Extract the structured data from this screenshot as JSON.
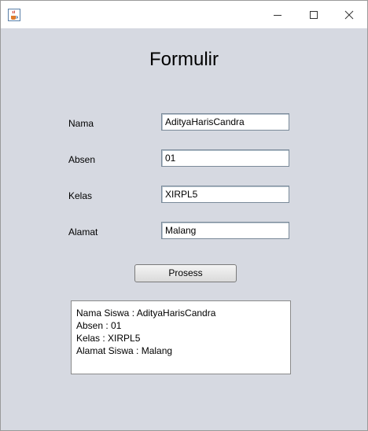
{
  "window": {
    "icon": "java-coffee-cup-icon",
    "controls": {
      "minimize": "minimize-icon",
      "maximize": "maximize-icon",
      "close": "close-icon"
    }
  },
  "form": {
    "title": "Formulir",
    "fields": {
      "nama": {
        "label": "Nama",
        "value": "AdityaHarisCandra"
      },
      "absen": {
        "label": "Absen",
        "value": "01"
      },
      "kelas": {
        "label": "Kelas",
        "value": "XIRPL5"
      },
      "alamat": {
        "label": "Alamat",
        "value": "Malang"
      }
    },
    "button_label": "Prosess"
  },
  "output": {
    "lines": [
      "Nama Siswa : AdityaHarisCandra",
      "Absen : 01",
      "Kelas : XIRPL5",
      "Alamat Siswa : Malang"
    ]
  },
  "colors": {
    "panel_bg": "#d6d9e1",
    "titlebar_bg": "#ffffff"
  }
}
